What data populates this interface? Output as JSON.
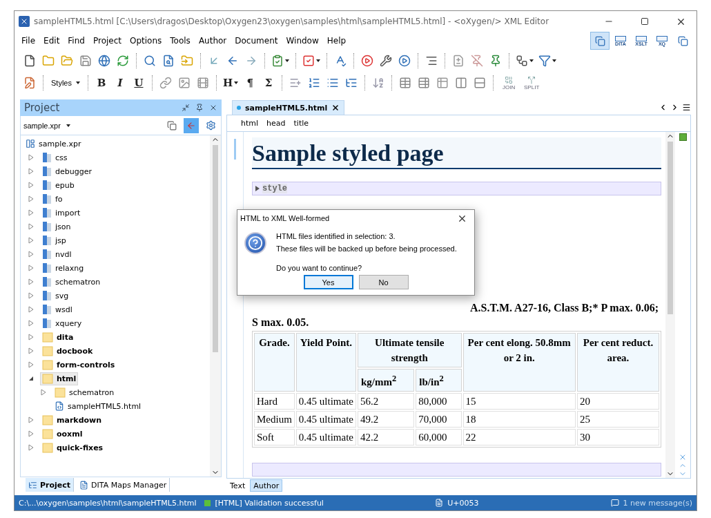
{
  "window": {
    "title": "sampleHTML5.html [C:\\Users\\dragos\\Desktop\\Oxygen23\\oxygen\\samples\\html\\sampleHTML5.html] - <oXygen/> XML Editor"
  },
  "menu": [
    "File",
    "Edit",
    "Find",
    "Project",
    "Options",
    "Tools",
    "Author",
    "Document",
    "Window",
    "Help"
  ],
  "perspectives": [
    {
      "kind": "icon",
      "selected": true
    },
    {
      "kind": "labeled",
      "label": "DITA",
      "selected": false
    },
    {
      "kind": "labeled",
      "label": "XSLT",
      "selected": false
    },
    {
      "kind": "labeled",
      "label": "XQ",
      "selected": false
    },
    {
      "kind": "icon",
      "selected": false
    }
  ],
  "toolbar_1": [
    {
      "kind": "icon"
    },
    {
      "kind": "icon"
    },
    {
      "kind": "icon"
    },
    {
      "kind": "icon"
    },
    {
      "kind": "icon"
    },
    {
      "kind": "icon"
    },
    {
      "kind": "sep"
    },
    {
      "kind": "icon"
    },
    {
      "kind": "icon"
    },
    {
      "kind": "icon"
    },
    {
      "kind": "sep"
    },
    {
      "kind": "icon"
    },
    {
      "kind": "icon"
    },
    {
      "kind": "icon"
    },
    {
      "kind": "sep"
    },
    {
      "kind": "menu"
    },
    {
      "kind": "sep"
    },
    {
      "kind": "menu"
    },
    {
      "kind": "sep"
    },
    {
      "kind": "icon"
    },
    {
      "kind": "sep"
    },
    {
      "kind": "icon"
    },
    {
      "kind": "icon"
    },
    {
      "kind": "icon"
    },
    {
      "kind": "sep"
    },
    {
      "kind": "icon"
    },
    {
      "kind": "sep"
    },
    {
      "kind": "icon"
    },
    {
      "kind": "icon"
    },
    {
      "kind": "icon"
    },
    {
      "kind": "sep"
    },
    {
      "kind": "menu"
    },
    {
      "kind": "menu"
    }
  ],
  "toolbar_2": [
    {
      "kind": "icon"
    },
    {
      "kind": "sep"
    },
    {
      "kind": "dropdown",
      "label": "Styles"
    },
    {
      "kind": "sep"
    },
    {
      "kind": "letter",
      "label": "B"
    },
    {
      "kind": "letter",
      "label": "I"
    },
    {
      "kind": "letter",
      "label": "U"
    },
    {
      "kind": "sep"
    },
    {
      "kind": "icon"
    },
    {
      "kind": "icon"
    },
    {
      "kind": "icon"
    },
    {
      "kind": "sep"
    },
    {
      "kind": "dropdown",
      "label": "H"
    },
    {
      "kind": "letter",
      "label": "¶"
    },
    {
      "kind": "letter",
      "label": "Σ"
    },
    {
      "kind": "sep"
    },
    {
      "kind": "icon"
    },
    {
      "kind": "icon"
    },
    {
      "kind": "icon"
    },
    {
      "kind": "icon"
    },
    {
      "kind": "sep"
    },
    {
      "kind": "icon"
    },
    {
      "kind": "sep"
    },
    {
      "kind": "icon"
    },
    {
      "kind": "icon"
    },
    {
      "kind": "icon"
    },
    {
      "kind": "icon"
    },
    {
      "kind": "icon"
    },
    {
      "kind": "sep"
    },
    {
      "kind": "tagged",
      "label": "JOIN"
    },
    {
      "kind": "tagged",
      "label": "SPLIT"
    }
  ],
  "project_panel": {
    "title": "Project",
    "project_file": "sample.xpr",
    "tree": {
      "name": "sample.xpr",
      "kind": "project",
      "selected": false,
      "children": [
        {
          "name": "css",
          "kind": "module",
          "expanded": false,
          "selected": false
        },
        {
          "name": "debugger",
          "kind": "module",
          "expanded": false,
          "selected": false
        },
        {
          "name": "epub",
          "kind": "module",
          "expanded": false,
          "selected": false
        },
        {
          "name": "fo",
          "kind": "module",
          "expanded": false,
          "selected": false
        },
        {
          "name": "import",
          "kind": "module",
          "expanded": false,
          "selected": false
        },
        {
          "name": "json",
          "kind": "module",
          "expanded": false,
          "selected": false
        },
        {
          "name": "jsp",
          "kind": "module",
          "expanded": false,
          "selected": false
        },
        {
          "name": "nvdl",
          "kind": "module",
          "expanded": false,
          "selected": false
        },
        {
          "name": "relaxng",
          "kind": "module",
          "expanded": false,
          "selected": false
        },
        {
          "name": "schematron",
          "kind": "module",
          "expanded": false,
          "selected": false
        },
        {
          "name": "svg",
          "kind": "module",
          "expanded": false,
          "selected": false
        },
        {
          "name": "wsdl",
          "kind": "module",
          "expanded": false,
          "selected": false
        },
        {
          "name": "xquery",
          "kind": "module",
          "expanded": false,
          "selected": false
        },
        {
          "name": "dita",
          "kind": "folder",
          "expanded": false,
          "selected": false
        },
        {
          "name": "docbook",
          "kind": "folder",
          "expanded": false,
          "selected": false
        },
        {
          "name": "form-controls",
          "kind": "folder",
          "expanded": false,
          "selected": false
        },
        {
          "name": "html",
          "kind": "folder",
          "expanded": true,
          "selected": true,
          "children": [
            {
              "name": "schematron",
              "kind": "subfolder",
              "expanded": false,
              "selected": false
            },
            {
              "name": "sampleHTML5.html",
              "kind": "file",
              "selected": false
            }
          ]
        },
        {
          "name": "markdown",
          "kind": "folder",
          "expanded": false,
          "selected": false
        },
        {
          "name": "ooxml",
          "kind": "folder",
          "expanded": false,
          "selected": false
        },
        {
          "name": "quick-fixes",
          "kind": "folder",
          "expanded": false,
          "selected": false
        }
      ]
    },
    "tabs": [
      {
        "label": "Project",
        "selected": true
      },
      {
        "label": "DITA Maps Manager",
        "selected": false
      }
    ]
  },
  "editor": {
    "tab": "sampleHTML5.html",
    "breadcrumb": [
      "html",
      "head",
      "title"
    ],
    "heading": "Sample styled page",
    "collapsed_element": "style",
    "paragraph": [
      "A.S.T.M. A27-16, Class B;* P max. 0.06;",
      "S max. 0.05."
    ],
    "table": {
      "header_rows": [
        [
          {
            "text": "Grade.",
            "kind": "tall"
          },
          {
            "text": "Yield Point.",
            "kind": "tall"
          },
          {
            "text": "Ultimate tensile strength",
            "kind": "wide"
          },
          {
            "text": "Per cent elong. 50.8mm or 2 in.",
            "kind": "tall"
          },
          {
            "text": "Per cent reduct. area.",
            "kind": "tall"
          }
        ],
        [
          {
            "text": "kg/mm$^{2}$",
            "kind": "unit"
          },
          {
            "text": "lb/in$^{2}$",
            "kind": "unit"
          }
        ]
      ],
      "rows": [
        [
          "Hard",
          "0.45 ultimate",
          "56.2",
          "80,000",
          "15",
          "20"
        ],
        [
          "Medium",
          "0.45 ultimate",
          "49.2",
          "70,000",
          "18",
          "25"
        ],
        [
          "Soft",
          "0.45 ultimate",
          "42.2",
          "60,000",
          "22",
          "30"
        ]
      ]
    },
    "modes": [
      {
        "label": "Text",
        "selected": false
      },
      {
        "label": "Author",
        "selected": true
      }
    ]
  },
  "dialog": {
    "title": "HTML to XML Well-formed",
    "lines": [
      "HTML files identified in selection: 3.",
      "These files will be backed up before being processed."
    ],
    "question": "Do you want to continue?",
    "buttons": [
      {
        "label": "Yes",
        "selected": true
      },
      {
        "label": "No",
        "selected": false
      }
    ]
  },
  "status_bar": {
    "path": "C:\\...\\oxygen\\samples\\html\\sampleHTML5.html",
    "validation": "[HTML] Validation successful",
    "character": "U+0053",
    "messages": "1 new message(s)"
  }
}
